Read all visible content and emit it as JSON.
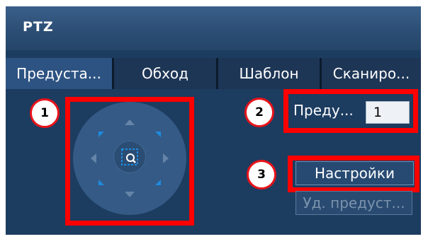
{
  "window": {
    "title": "PTZ"
  },
  "tabs": [
    {
      "label": "Предуста..."
    },
    {
      "label": "Обход"
    },
    {
      "label": "Шаблон"
    },
    {
      "label": "Сканиро..."
    }
  ],
  "markers": [
    "1",
    "2",
    "3"
  ],
  "preset": {
    "label": "Преду...",
    "value": "1"
  },
  "buttons": {
    "settings": "Настройки",
    "delete_preset": "Уд. предуст..."
  },
  "colors": {
    "highlight": "#ff0000",
    "accent": "#1e8be0",
    "panel": "#1c3c60"
  },
  "icons": {
    "zoom": "zoom-focus-icon",
    "up": "up-arrow-icon",
    "down": "down-arrow-icon",
    "left": "left-arrow-icon",
    "right": "right-arrow-icon"
  }
}
